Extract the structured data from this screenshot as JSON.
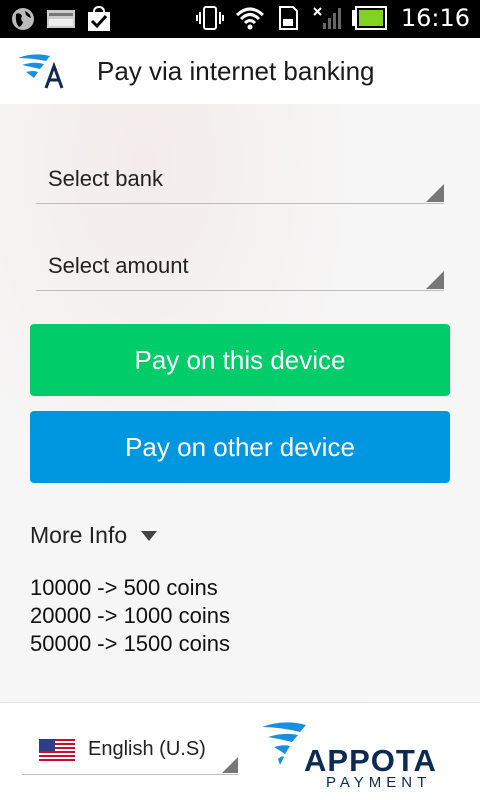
{
  "status_bar": {
    "time": "16:16",
    "icons": [
      "globe-icon",
      "card-icon",
      "bag-check-icon",
      "vibrate-icon",
      "wifi-icon",
      "sd-card-icon",
      "signal-off-icon",
      "battery-icon"
    ]
  },
  "header": {
    "title": "Pay via internet banking",
    "logo_icon": "appota-a-icon"
  },
  "form": {
    "bank_select": "Select bank",
    "amount_select": "Select amount",
    "pay_this_device": "Pay on this device",
    "pay_other_device": "Pay on other device"
  },
  "more_info": {
    "label": "More Info",
    "rates": [
      "10000 -> 500 coins",
      "20000 -> 1000 coins",
      "50000 -> 1500 coins"
    ]
  },
  "footer": {
    "language": "English (U.S)",
    "flag_icon": "us-flag-icon",
    "brand": {
      "name": "APPOTA",
      "sub": "PAYMENT"
    }
  },
  "colors": {
    "green": "#00cc6a",
    "blue": "#0096e0",
    "brand_navy": "#0d2a53",
    "brand_blue": "#1a8fe0"
  }
}
